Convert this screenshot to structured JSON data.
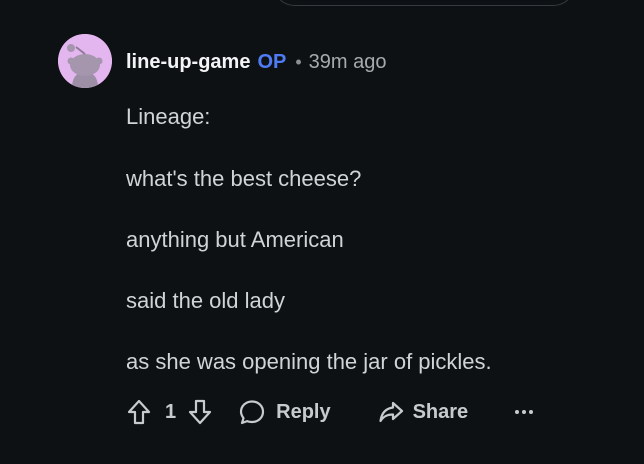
{
  "comment": {
    "username": "line-up-game",
    "op_badge": "OP",
    "separator": "•",
    "time": "39m ago",
    "lines": [
      "Lineage:",
      "what's the best cheese?",
      "anything but American",
      "said the old lady",
      "as she was opening the jar of pickles."
    ],
    "avatar_color": "#e4b6f0",
    "op_color": "#4f7cf5"
  },
  "actions": {
    "upvote_icon": "upvote-arrow-icon",
    "vote_count": "1",
    "downvote_icon": "downvote-arrow-icon",
    "reply_label": "Reply",
    "reply_icon": "speech-bubble-icon",
    "share_label": "Share",
    "share_icon": "share-arrow-icon",
    "more_icon": "ellipsis-icon",
    "more_label": "•••"
  },
  "theme": {
    "background": "#0e1113",
    "text": "#d0d4d6"
  }
}
